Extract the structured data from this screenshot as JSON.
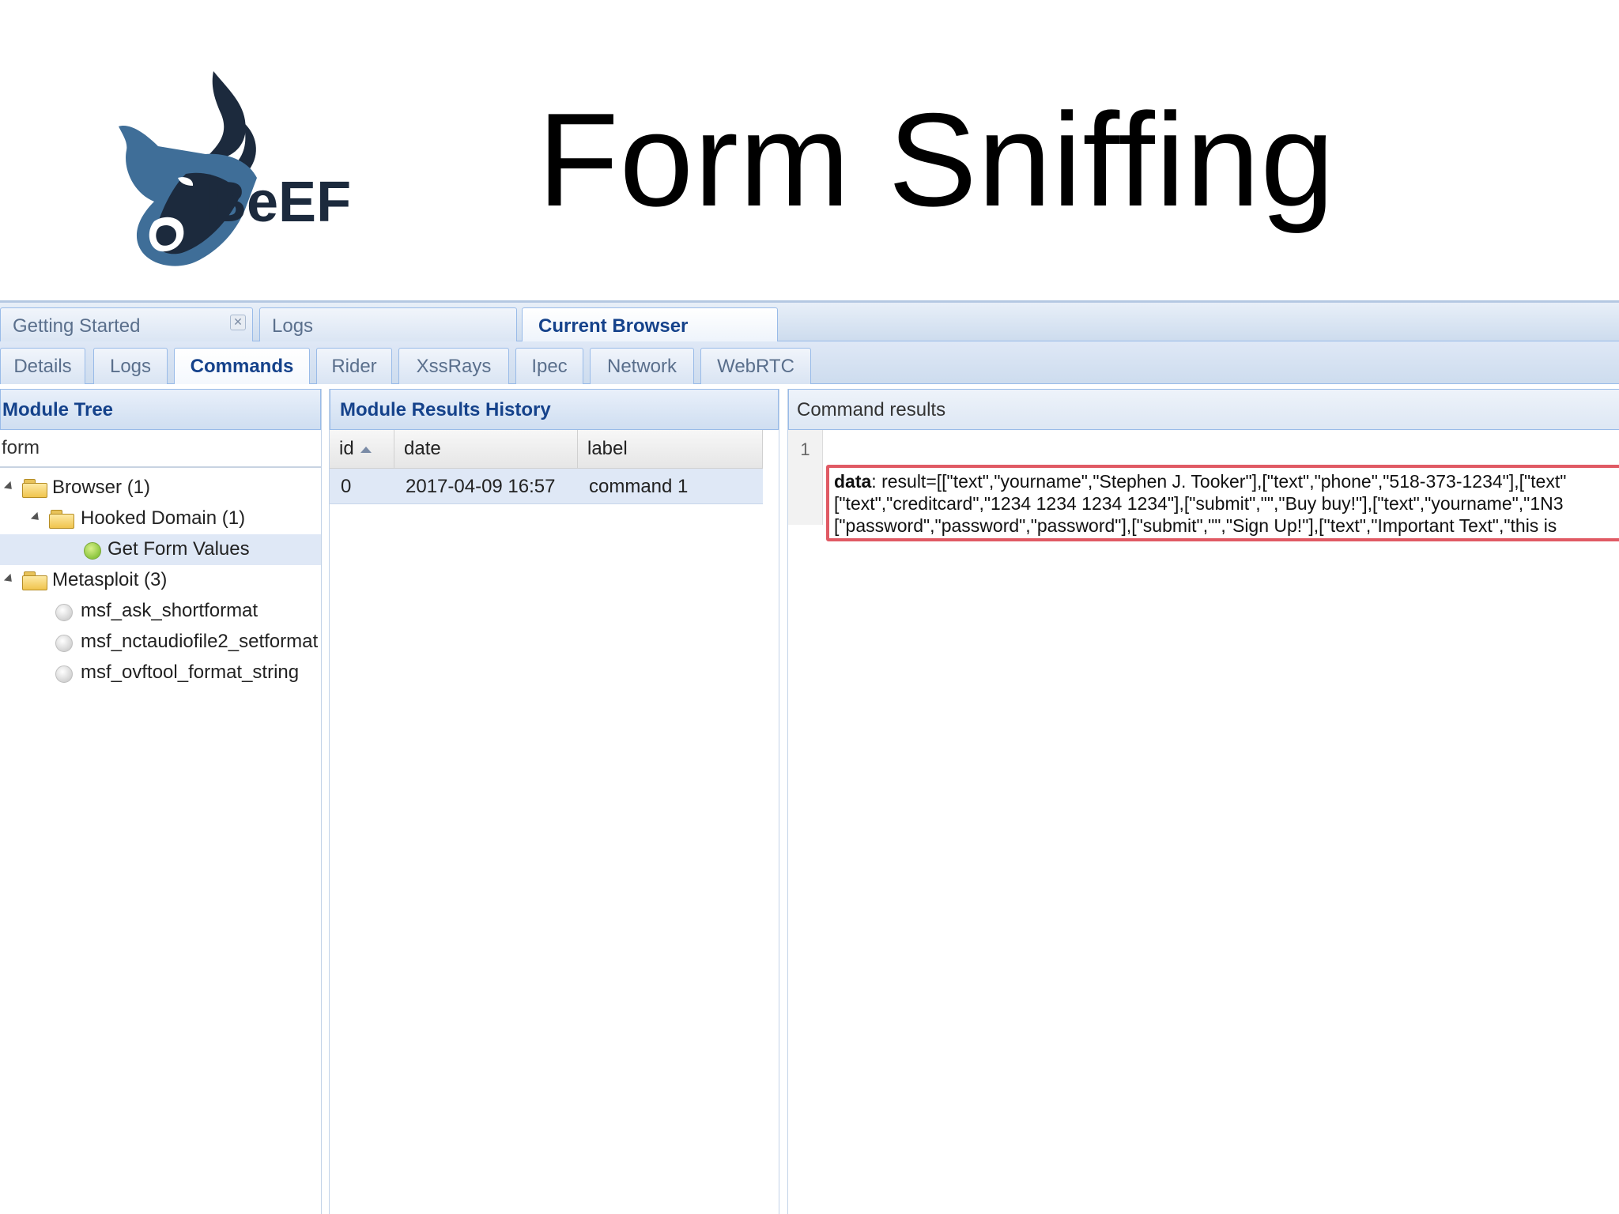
{
  "slide": {
    "title": "Form Sniffing",
    "logo_text": "BeEF"
  },
  "tabs_top": [
    {
      "label": "Getting Started",
      "closable": true
    },
    {
      "label": "Logs"
    },
    {
      "label": "Current Browser",
      "active": true
    }
  ],
  "tabs_sub": [
    {
      "label": "Details"
    },
    {
      "label": "Logs"
    },
    {
      "label": "Commands",
      "active": true
    },
    {
      "label": "Rider"
    },
    {
      "label": "XssRays"
    },
    {
      "label": "Ipec"
    },
    {
      "label": "Network"
    },
    {
      "label": "WebRTC"
    }
  ],
  "module_tree": {
    "header": "Module Tree",
    "filter_value": "form",
    "nodes": [
      {
        "label": "Browser (1)",
        "type": "folder",
        "level": 0
      },
      {
        "label": "Hooked Domain (1)",
        "type": "folder",
        "level": 1
      },
      {
        "label": "Get Form Values",
        "type": "module",
        "status": "green",
        "level": 2,
        "selected": true
      },
      {
        "label": "Metasploit (3)",
        "type": "folder",
        "level": 0
      },
      {
        "label": "msf_ask_shortformat",
        "type": "module",
        "status": "grey",
        "level": 1
      },
      {
        "label": "msf_nctaudiofile2_setformat",
        "type": "module",
        "status": "grey",
        "level": 1
      },
      {
        "label": "msf_ovftool_format_string",
        "type": "module",
        "status": "grey",
        "level": 1
      }
    ]
  },
  "history": {
    "header": "Module Results History",
    "columns": [
      "id",
      "date",
      "label"
    ],
    "rows": [
      {
        "id": "0",
        "date": "2017-04-09 16:57",
        "label": "command 1"
      }
    ]
  },
  "results": {
    "header": "Command results",
    "line_number": "1",
    "key": "data",
    "lines": [
      ": result=[[\"text\",\"yourname\",\"Stephen J. Tooker\"],[\"text\",\"phone\",\"518-373-1234\"],[\"text\"",
      "[\"text\",\"creditcard\",\"1234 1234 1234 1234\"],[\"submit\",\"\",\"Buy buy!\"],[\"text\",\"yourname\",\"1N3",
      "[\"password\",\"password\",\"password\"],[\"submit\",\"\",\"Sign Up!\"],[\"text\",\"Important Text\",\"this is"
    ]
  },
  "colors": {
    "panel_header_text": "#15428b",
    "highlight_border": "#e05a64",
    "tab_border": "#99bbe8"
  }
}
